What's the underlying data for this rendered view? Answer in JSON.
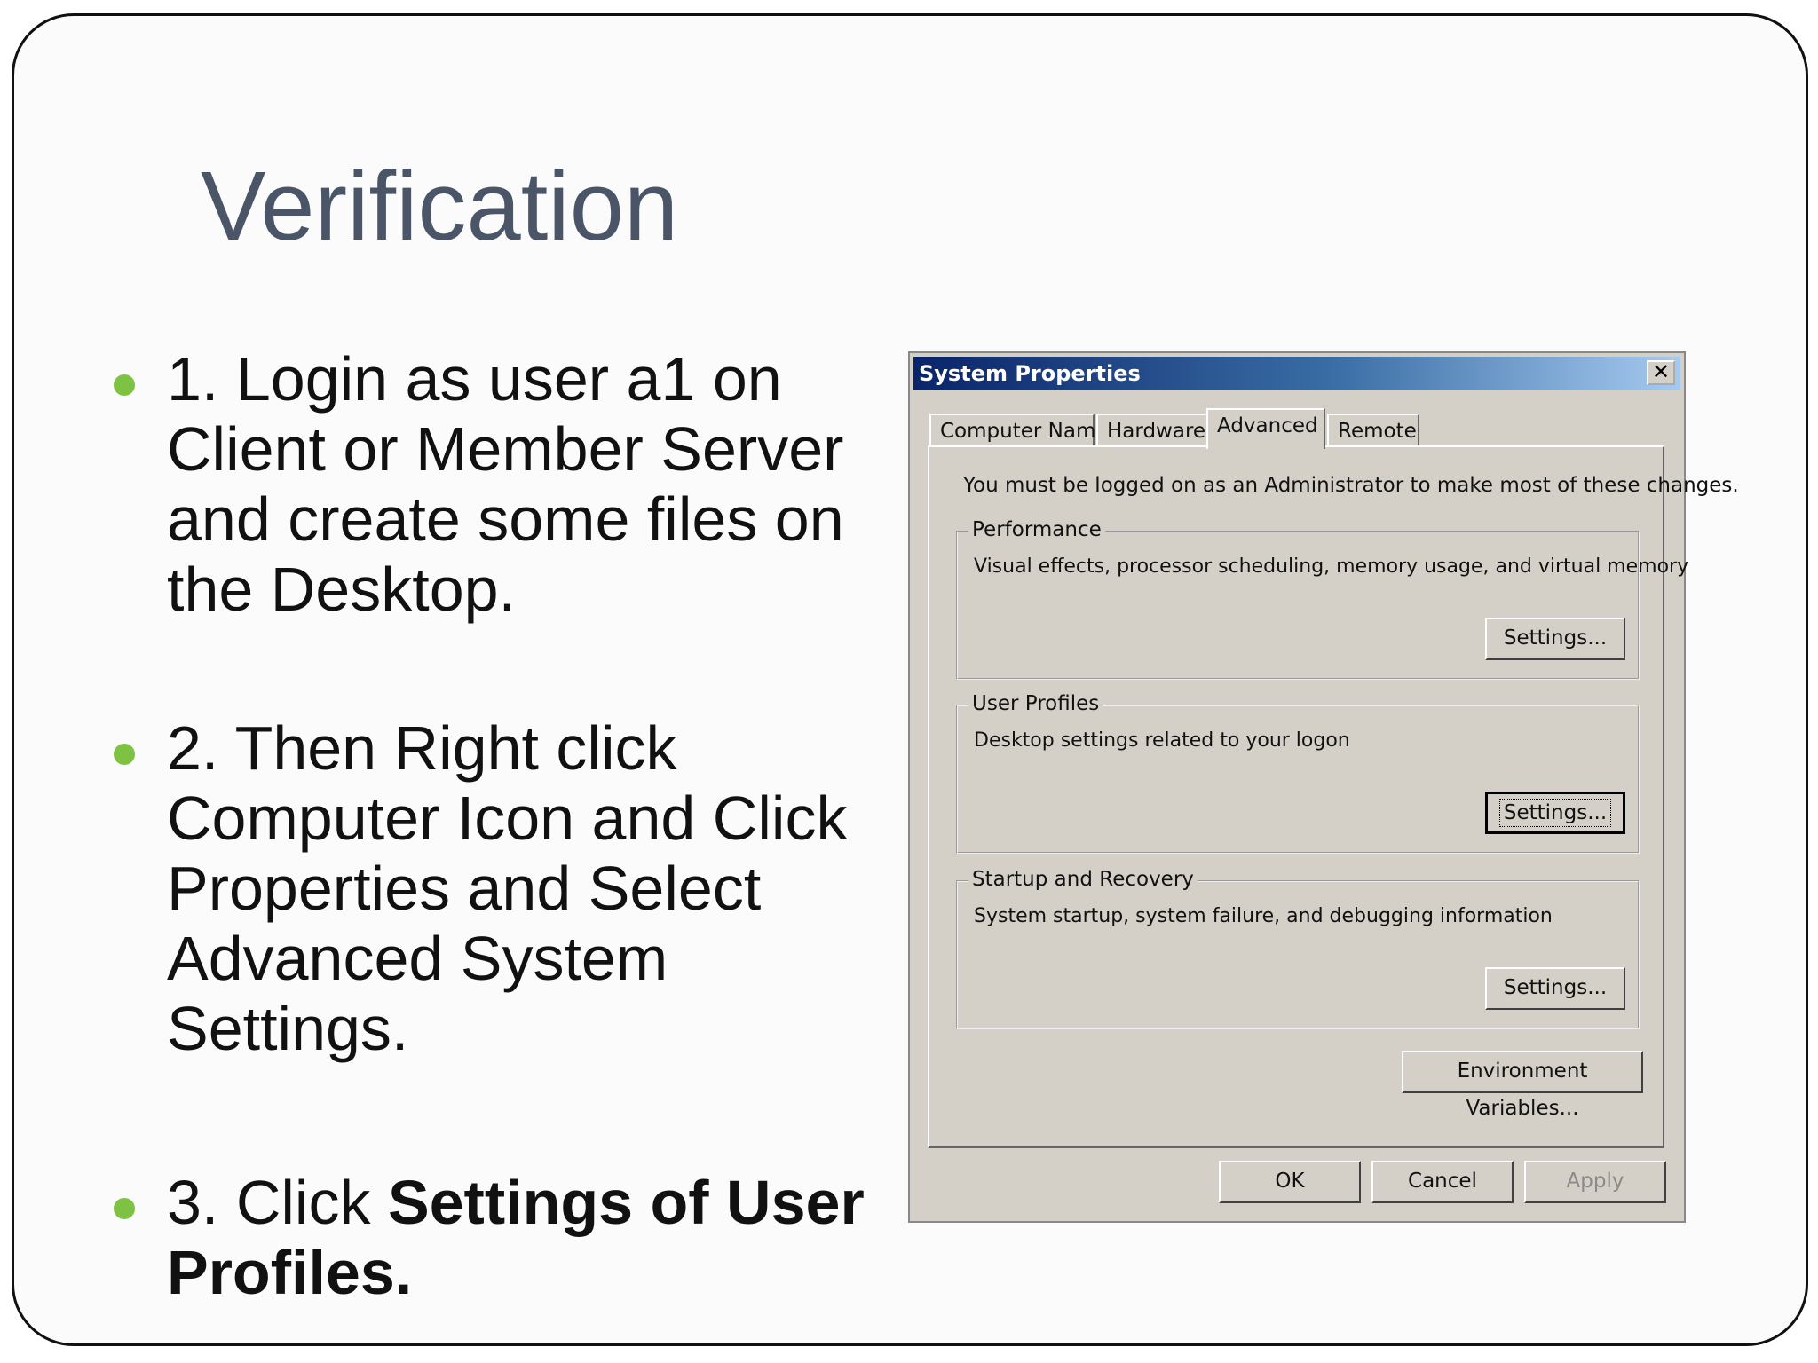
{
  "slide": {
    "title": "Verification",
    "bullets": [
      {
        "text": "1. Login as user a1 on Client or Member Server and create some files on the Desktop."
      },
      {
        "text": "2. Then Right click Computer Icon and Click Properties and Select Advanced System Settings."
      },
      {
        "prefix": "3. Click ",
        "bold": "Settings of User Profiles."
      }
    ],
    "bullet_color": "#7dc242",
    "title_color": "#4b5568"
  },
  "dialog": {
    "title": "System Properties",
    "close_glyph": "✕",
    "tabs": [
      "Computer Name",
      "Hardware",
      "Advanced",
      "Remote"
    ],
    "active_tab": "Advanced",
    "admin_note": "You must be logged on as an Administrator to make most of these changes.",
    "groups": [
      {
        "label": "Performance",
        "description": "Visual effects, processor scheduling, memory usage, and virtual memory",
        "button": "Settings..."
      },
      {
        "label": "User Profiles",
        "description": "Desktop settings related to your logon",
        "button": "Settings..."
      },
      {
        "label": "Startup and Recovery",
        "description": "System startup, system failure, and debugging information",
        "button": "Settings..."
      }
    ],
    "env_button": "Environment Variables...",
    "ok": "OK",
    "cancel": "Cancel",
    "apply": "Apply"
  }
}
